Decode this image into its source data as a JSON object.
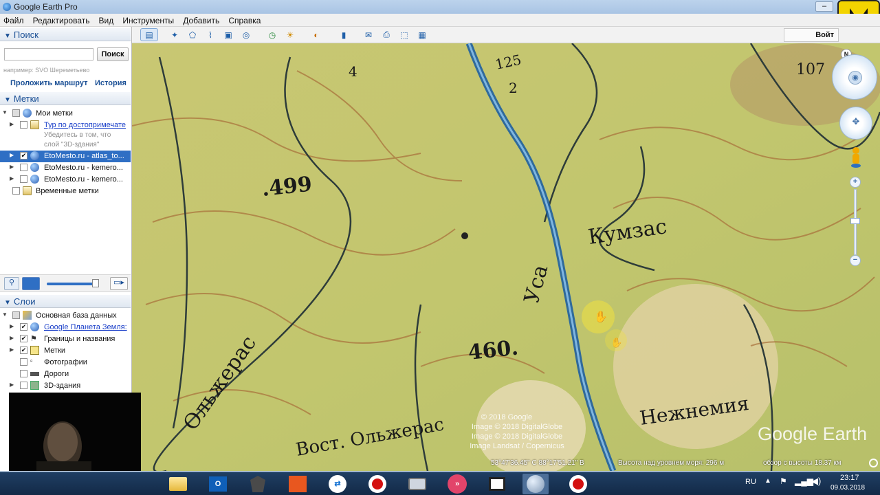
{
  "window": {
    "title": "Google Earth Pro",
    "minimize_label": "–"
  },
  "menu": [
    "Файл",
    "Редактировать",
    "Вид",
    "Инструменты",
    "Добавить",
    "Справка"
  ],
  "toolbar": {
    "signin_label": "Войт"
  },
  "search": {
    "header": "Поиск",
    "placeholder": "",
    "button_label": "Поиск",
    "hint": "например: SVO Шереметьево",
    "route_link": "Проложить маршрут",
    "history_link": "История"
  },
  "places": {
    "header": "Метки",
    "items": [
      {
        "label": "Мои метки"
      },
      {
        "label": "Тур по достопримечате"
      },
      {
        "label": "Убедитесь в том, что"
      },
      {
        "label": "слой \"3D-здания\""
      },
      {
        "label": "EtoMesto.ru - atlas_to..."
      },
      {
        "label": "EtoMesto.ru - kemero..."
      },
      {
        "label": "EtoMesto.ru - kemero..."
      },
      {
        "label": "Временные метки"
      }
    ]
  },
  "layers": {
    "header": "Слои",
    "items": [
      {
        "label": "Основная база данных"
      },
      {
        "label": "Google Планета Земля:"
      },
      {
        "label": "Границы и названия"
      },
      {
        "label": "Метки"
      },
      {
        "label": "Фотографии"
      },
      {
        "label": "Дороги"
      },
      {
        "label": "3D-здания"
      }
    ]
  },
  "map": {
    "labels": {
      "contour_499": ".499",
      "contour_460": "460.",
      "kumzas": "Кумзас",
      "usa": "Уса",
      "olzheras": "Ольжерас",
      "vost_olzheras": "Вост. Ольжерас",
      "nezhnemia": "Нежнемия",
      "hill_107": "107",
      "river_ratio_top": "125",
      "river_ratio_bottom": "2",
      "num_4": "4"
    },
    "attribution": [
      "© 2018 Google",
      "Image © 2018 DigitalGlobe",
      "Image © 2018 DigitalGlobe",
      "Image Landsat / Copernicus"
    ],
    "watermark": "Google Earth",
    "compass_letter": "N"
  },
  "status": {
    "coords": "53°47'36.45\" С   88°17'51.21\" В",
    "elevation": "Высота над уровнем моря:   296 м",
    "eye_alt": "обзор с высоты  18.37 км"
  },
  "taskbar": {
    "lang": "RU",
    "time": "23:17",
    "date": "09.03.2018",
    "apps": [
      "folder-app",
      "outlook-app",
      "world-of-tanks-app",
      "office-app",
      "teamviewer-app",
      "record-app",
      "camera-app",
      "arrows-app",
      "film-app",
      "google-earth-app",
      "record2-app"
    ]
  },
  "colors": {
    "accent": "#1a4f95",
    "selection": "#2f6fc4",
    "map_base": "#c4c46c",
    "taskbar": "#1a3453",
    "owl_bg": "#f3d400"
  }
}
